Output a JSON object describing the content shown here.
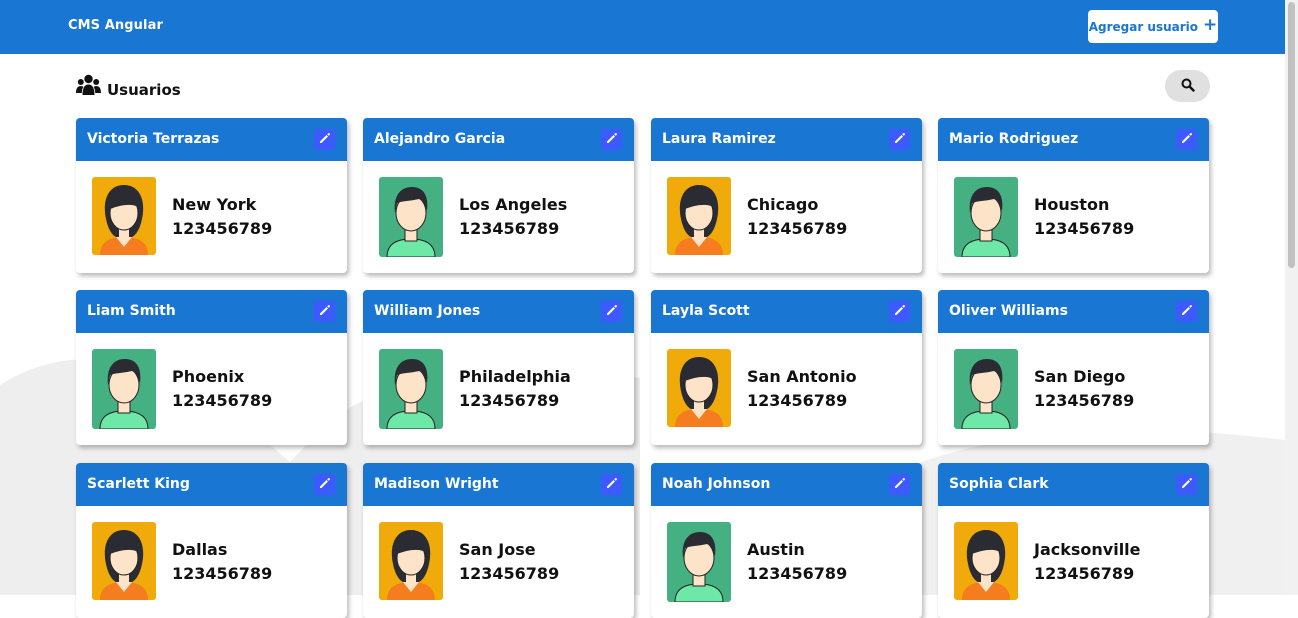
{
  "app": {
    "title": "CMS Angular",
    "add_user_label": "Agregar usuario",
    "add_user_icon": "plus-icon"
  },
  "section": {
    "title": "Usuarios",
    "icon": "users-icon",
    "search_icon": "search-icon"
  },
  "colors": {
    "primary": "#1976d2",
    "edit_button": "#3d5afe",
    "avatar_female_bg": "#f0ab0b",
    "avatar_male_bg": "#45b082"
  },
  "users": [
    {
      "name": "Victoria Terrazas",
      "city": "New York",
      "phone": "123456789",
      "avatar": "female"
    },
    {
      "name": "Alejandro Garcia",
      "city": "Los Angeles",
      "phone": "123456789",
      "avatar": "male"
    },
    {
      "name": "Laura Ramirez",
      "city": "Chicago",
      "phone": "123456789",
      "avatar": "female"
    },
    {
      "name": "Mario Rodriguez",
      "city": "Houston",
      "phone": "123456789",
      "avatar": "male"
    },
    {
      "name": "Liam Smith",
      "city": "Phoenix",
      "phone": "123456789",
      "avatar": "male"
    },
    {
      "name": "William Jones",
      "city": "Philadelphia",
      "phone": "123456789",
      "avatar": "male"
    },
    {
      "name": "Layla Scott",
      "city": "San Antonio",
      "phone": "123456789",
      "avatar": "female"
    },
    {
      "name": "Oliver Williams",
      "city": "San Diego",
      "phone": "123456789",
      "avatar": "male"
    },
    {
      "name": "Scarlett King",
      "city": "Dallas",
      "phone": "123456789",
      "avatar": "female"
    },
    {
      "name": "Madison Wright",
      "city": "San Jose",
      "phone": "123456789",
      "avatar": "female"
    },
    {
      "name": "Noah Johnson",
      "city": "Austin",
      "phone": "123456789",
      "avatar": "male"
    },
    {
      "name": "Sophia Clark",
      "city": "Jacksonville",
      "phone": "123456789",
      "avatar": "female"
    }
  ]
}
